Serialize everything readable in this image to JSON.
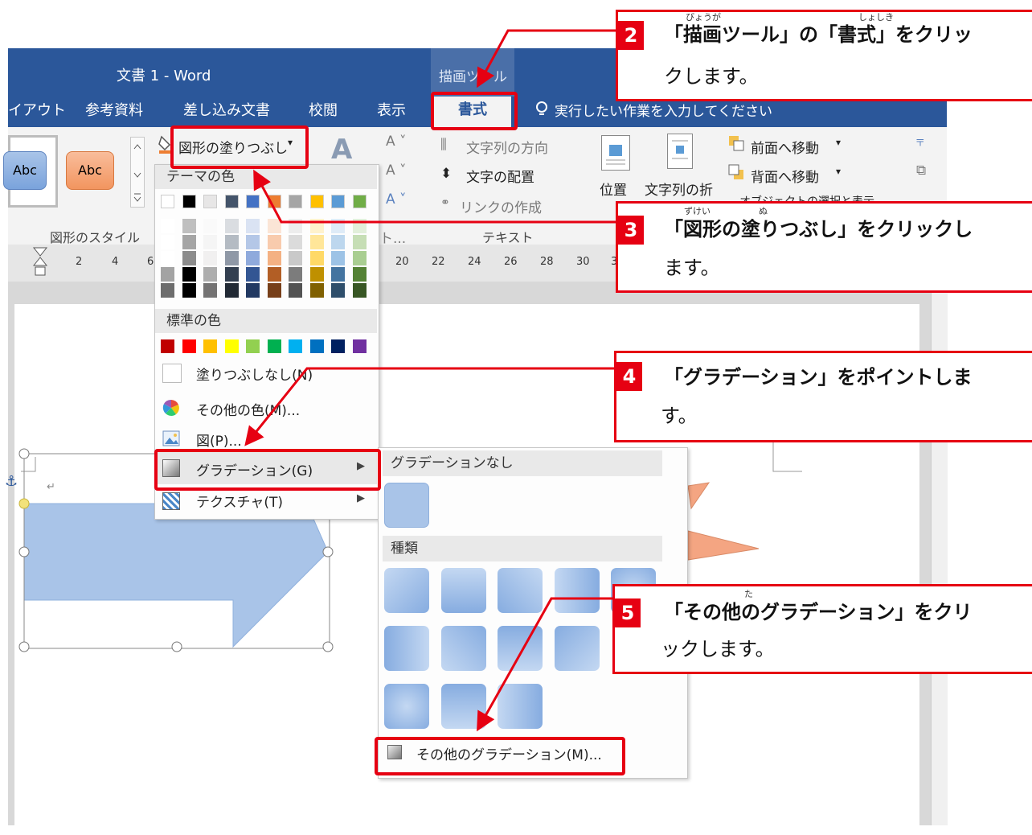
{
  "window": {
    "title": "文書 1 - Word",
    "context_label": "描画ツール",
    "tabs": [
      "イアウト",
      "参考資料",
      "差し込み文書",
      "校閲",
      "表示",
      "書式"
    ],
    "tell_me": "実行したい作業を入力してください"
  },
  "ribbon": {
    "shape_styles": {
      "thumb1": "Abc",
      "thumb2": "Abc",
      "label": "図形のスタイル"
    },
    "fill_button": "図形の塗りつぶし",
    "text_direction": "文字列の方向",
    "text_align": "文字の配置",
    "create_link": "リンクの作成",
    "text_group": "テキスト",
    "position": "位置",
    "wrap_text": "文字列の折",
    "bring_forward": "前面へ移動",
    "send_backward": "背面へ移動",
    "overflow_text": "オブジェクトの選択と表示",
    "group_partial": "ト..."
  },
  "ruler": {
    "numbers": [
      "2",
      "4",
      "6",
      "20",
      "22",
      "24",
      "26",
      "28",
      "30",
      "3"
    ]
  },
  "fill_menu": {
    "theme_colors_header": "テーマの色",
    "standard_colors_header": "標準の色",
    "theme_top_colors": [
      "#ffffff",
      "#000000",
      "#e7e6e6",
      "#44546a",
      "#4472c4",
      "#ed7d31",
      "#a5a5a5",
      "#ffc000",
      "#5b9bd5",
      "#70ad47"
    ],
    "standard_colors": [
      "#c00000",
      "#ff0000",
      "#ffc000",
      "#ffff00",
      "#92d050",
      "#00b050",
      "#00b0f0",
      "#0070c0",
      "#002060",
      "#7030a0"
    ],
    "items": {
      "no_fill": "塗りつぶしなし(N)",
      "more_colors": "その他の色(M)...",
      "picture": "図(P)...",
      "gradient": "グラデーション(G)",
      "texture": "テクスチャ(T)"
    }
  },
  "gradient_menu": {
    "no_gradient_header": "グラデーションなし",
    "variations_header": "種類",
    "more_gradients": "その他のグラデーション(M)..."
  },
  "callouts": [
    {
      "num": "2",
      "text_a": "「描画ツール」の「書式」をクリッ",
      "text_b": "クします。",
      "ruby_1": "びょうが",
      "ruby_2": "しょしき"
    },
    {
      "num": "3",
      "text_a": "「図形の塗りつぶし」をクリックし",
      "text_b": "ます。",
      "ruby_1": "ずけい",
      "ruby_2": "ぬ"
    },
    {
      "num": "4",
      "text_a": "「グラデーション」をポイントしま",
      "text_b": "す。"
    },
    {
      "num": "5",
      "text_a": "「その他のグラデーション」をクリ",
      "text_b": "ックします。",
      "ruby_1": "た"
    }
  ],
  "colors": {
    "word_blue": "#2b579a",
    "callout_red": "#e60012",
    "shape_blue": "#a9c4e8",
    "shape_orange": "#f4a582"
  }
}
